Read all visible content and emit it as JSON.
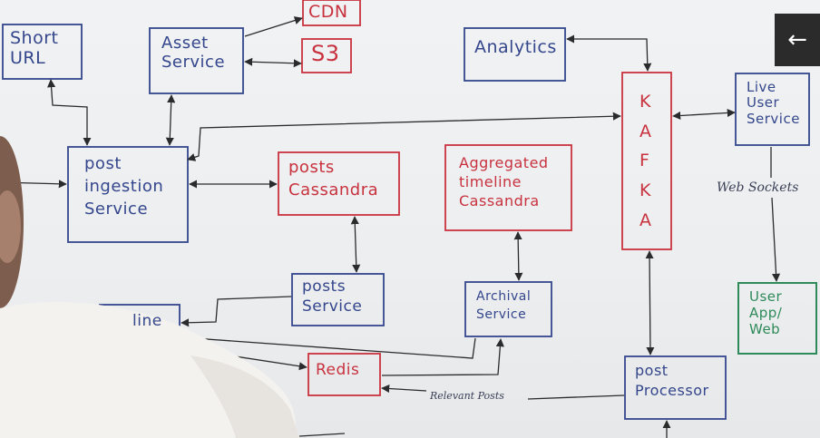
{
  "boxes": {
    "short_url": "Short\nURL",
    "asset_service": "Asset\nService",
    "cdn": "CDN",
    "s3": "S3",
    "analytics": "Analytics",
    "kafka": "K\nA\nF\nK\nA",
    "live_user_service": "Live\nUser\nService",
    "post_ingestion": "post\ningestion\nService",
    "posts_cassandra": "posts\nCassandra",
    "aggregated_timeline": "Aggregated\ntimeline\nCassandra",
    "posts_service": "posts\nService",
    "archival_service": "Archival\nService",
    "timeline_partial": "line",
    "redis": "Redis",
    "post_processor": "post\nProcessor",
    "user_app": "User\nApp/\nWeb"
  },
  "labels": {
    "web_sockets": "Web Sockets",
    "relevant_posts": "Relevant Posts"
  },
  "nav": {
    "back_glyph": "←"
  },
  "colors": {
    "blue_ink": "#34468c",
    "red_ink": "#c8323e",
    "green_ink": "#2e8a58",
    "black_ink": "#2b2b2b"
  }
}
